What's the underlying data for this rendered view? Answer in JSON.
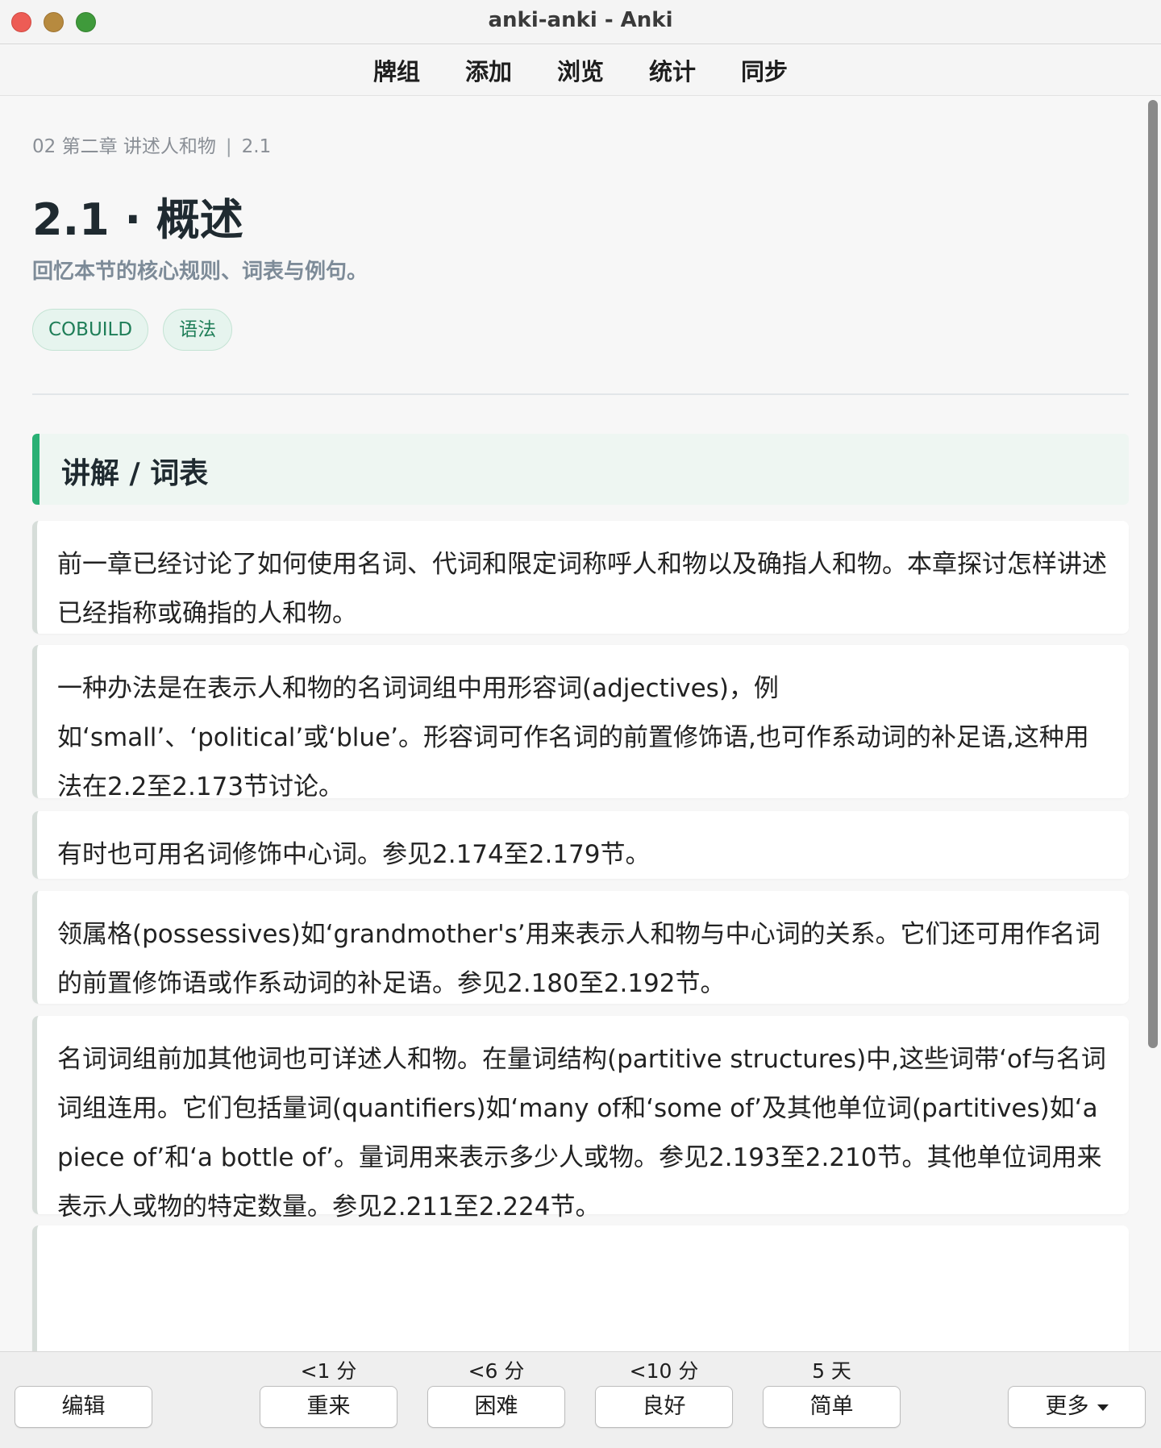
{
  "window": {
    "title": "anki-anki - Anki"
  },
  "toolbar": {
    "items": [
      "牌组",
      "添加",
      "浏览",
      "统计",
      "同步"
    ]
  },
  "card": {
    "breadcrumb": {
      "deck": "02 第二章 讲述人和物",
      "section": "2.1"
    },
    "title": "2.1 · 概述",
    "subtitle": "回忆本节的核心规则、词表与例句。",
    "tags": [
      "COBUILD",
      "语法"
    ],
    "section_header": "讲解 / 词表",
    "paragraphs": [
      "前一章已经讨论了如何使用名词、代词和限定词称呼人和物以及确指人和物。本章探讨怎样讲述已经指称或确指的人和物。",
      "一种办法是在表示人和物的名词词组中用形容词(adjectives)，例如‘small’、‘political’或‘blue’。形容词可作名词的前置修饰语,也可作系动词的补足语,这种用法在2.2至2.173节讨论。",
      "有时也可用名词修饰中心词。参见2.174至2.179节。",
      "领属格(possessives)如‘grandmother's’用来表示人和物与中心词的关系。它们还可用作名词的前置修饰语或作系动词的补足语。参见2.180至2.192节。",
      "名词词组前加其他词也可详述人和物。在量词结构(partitive structures)中,这些词带‘of与名词词组连用。它们包括量词(quantifiers)如‘many of和‘some of’及其他单位词(partitives)如‘a piece of’和‘a bottle of’。量词用来表示多少人或物。参见2.193至2.210节。其他单位词用来表示人或物的特定数量。参见2.211至2.224节。"
    ]
  },
  "bottom": {
    "edit_label": "编辑",
    "more_label": "更多",
    "answers": [
      {
        "label": "重来",
        "interval": "<1 分"
      },
      {
        "label": "困难",
        "interval": "<6 分"
      },
      {
        "label": "良好",
        "interval": "<10 分"
      },
      {
        "label": "简单",
        "interval": "5 天"
      }
    ]
  }
}
